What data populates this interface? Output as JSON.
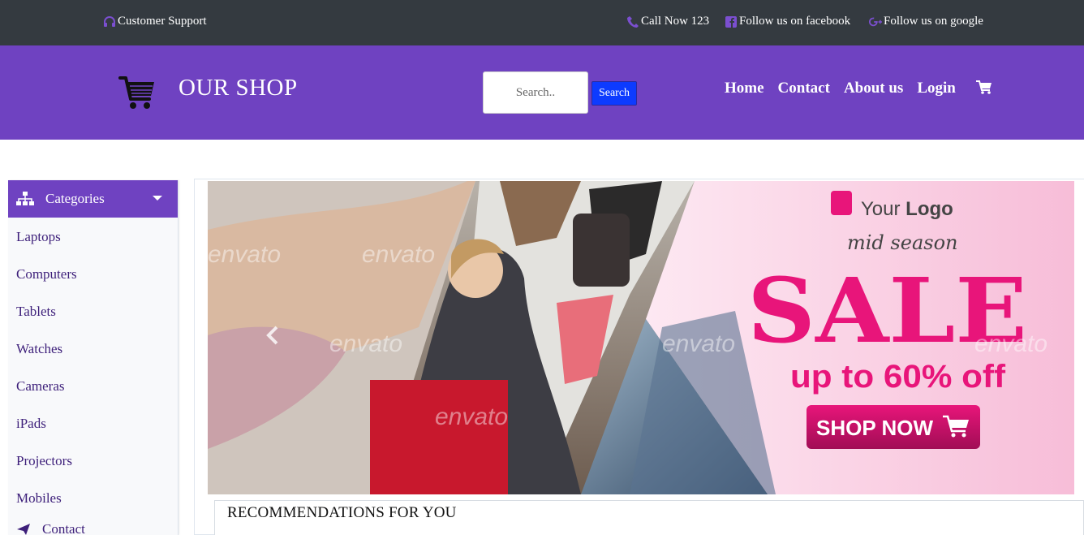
{
  "topbar": {
    "support_label": "Customer Support",
    "call_label": "Call Now 123",
    "facebook_label": "Follow us on facebook",
    "google_label": "Follow us on google"
  },
  "header": {
    "shop_title": "OUR SHOP",
    "search_placeholder": "Search..",
    "search_button": "Search",
    "nav": [
      "Home",
      "Contact",
      "About us",
      "Login"
    ]
  },
  "sidebar": {
    "title": "Categories",
    "items": [
      "Laptops",
      "Computers",
      "Tablets",
      "Watches",
      "Cameras",
      "iPads",
      "Projectors",
      "Mobiles",
      "Contact"
    ]
  },
  "banner": {
    "logo_text_1": "Your",
    "logo_text_2": "Logo",
    "season": "mid season",
    "headline": "SALE",
    "discount": "up to 60% off",
    "cta": "SHOP NOW",
    "watermark": "envato"
  },
  "recommendations": {
    "title": "RECOMMENDATIONS FOR YOU"
  },
  "colors": {
    "topbar": "#343a40",
    "brand": "#6f42c1",
    "search_button": "#0d3bff",
    "sale_pink": "#e8157a"
  }
}
